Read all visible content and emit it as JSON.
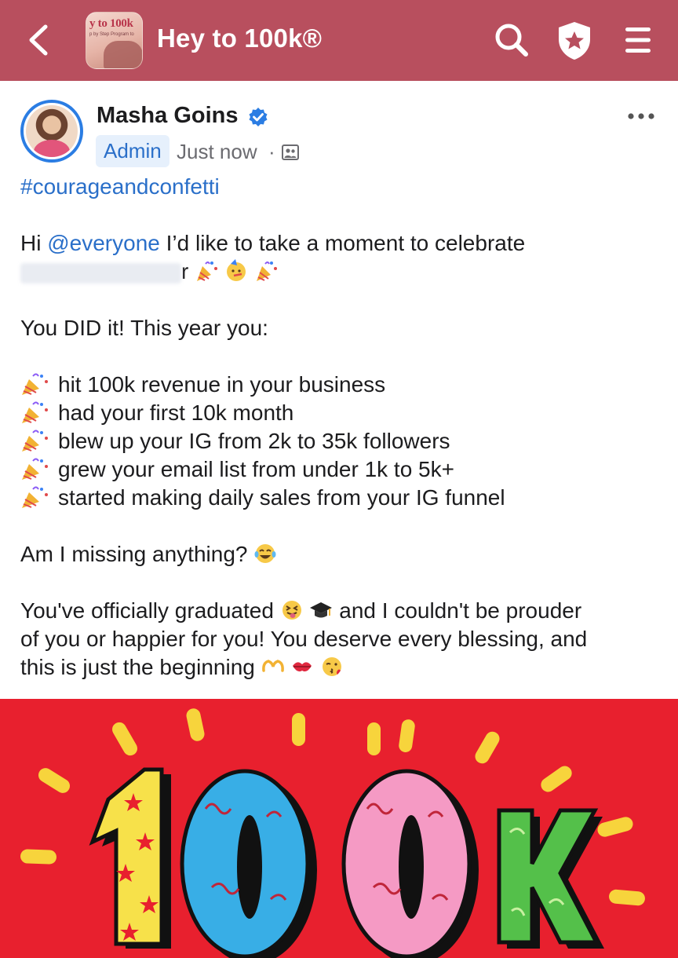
{
  "topbar": {
    "title": "Hey to 100k®",
    "thumb_title": "y to 100k",
    "thumb_subtitle": "p by Step Program to",
    "colors": {
      "background": "#b84f5e",
      "icon": "#ffffff"
    },
    "icons": [
      "chevron-left-icon",
      "search-icon",
      "shield-star-icon",
      "menu-icon"
    ]
  },
  "post": {
    "author": "Masha Goins",
    "role_badge": "Admin",
    "timestamp": "Just now",
    "separator": "·",
    "hashtag": "#courageandconfetti",
    "intro_prefix": "Hi ",
    "mention": "@everyone",
    "intro_suffix": " I’d like to take a moment to celebrate",
    "name_tail": "r",
    "you_did_it": "You DID it! This year you:",
    "bullets": [
      "hit 100k revenue in your business",
      "had your first 10k month",
      "blew up your IG from 2k to 35k followers",
      "grew your email list from under 1k to 5k+",
      "started making daily sales from your IG funnel"
    ],
    "missing": "Am I missing anything?",
    "graduated_1": "You've officially graduated ",
    "graduated_1b": " and I couldn't be prouder",
    "graduated_2": "of you or happier for you! You deserve every blessing, and",
    "graduated_3": "this is just the beginning ",
    "image_text": "100k",
    "colors": {
      "link": "#2a6fc9",
      "badge_bg": "#e6f0fc",
      "verified": "#2b7de3",
      "banner_bg": "#e8202e"
    }
  }
}
